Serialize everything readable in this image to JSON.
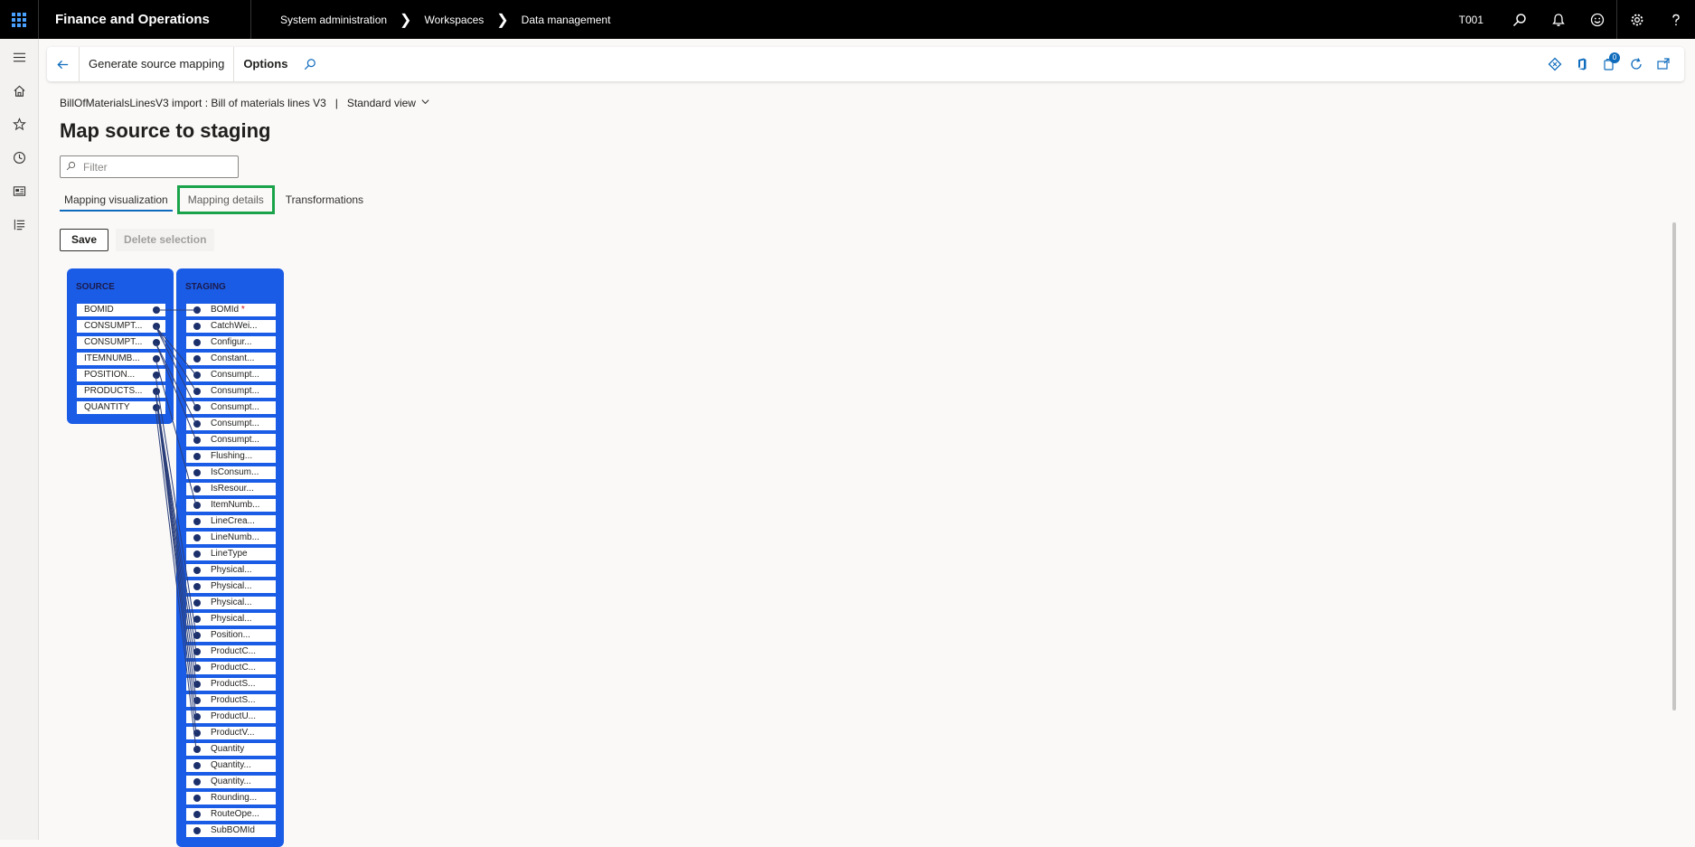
{
  "topbar": {
    "app_name": "Finance and Operations",
    "breadcrumbs": [
      "System administration",
      "Workspaces",
      "Data management"
    ],
    "company": "T001"
  },
  "actionbar": {
    "generate_label": "Generate source mapping",
    "options_label": "Options",
    "notification_count": "0"
  },
  "page": {
    "header_entity": "BillOfMaterialsLinesV3 import : Bill of materials lines V3",
    "header_separator": "|",
    "view_label": "Standard view",
    "title": "Map source to staging",
    "filter_placeholder": "Filter"
  },
  "tabs": [
    {
      "label": "Mapping visualization"
    },
    {
      "label": "Mapping details"
    },
    {
      "label": "Transformations"
    }
  ],
  "buttons": {
    "save": "Save",
    "delete_selection": "Delete selection"
  },
  "mapping": {
    "source_title": "SOURCE",
    "staging_title": "STAGING",
    "source_fields": [
      "BOMID",
      "CONSUMPT...",
      "CONSUMPT...",
      "ITEMNUMB...",
      "POSITION...",
      "PRODUCTS...",
      "QUANTITY"
    ],
    "staging_fields": [
      "BOMId",
      "CatchWei...",
      "Configur...",
      "Constant...",
      "Consumpt...",
      "Consumpt...",
      "Consumpt...",
      "Consumpt...",
      "Consumpt...",
      "Flushing...",
      "IsConsum...",
      "IsResour...",
      "ItemNumb...",
      "LineCrea...",
      "LineNumb...",
      "LineType",
      "Physical...",
      "Physical...",
      "Physical...",
      "Physical...",
      "Position...",
      "ProductC...",
      "ProductC...",
      "ProductS...",
      "ProductS...",
      "ProductU...",
      "ProductV...",
      "Quantity",
      "Quantity...",
      "Quantity...",
      "Rounding...",
      "RouteOpe...",
      "SubBOMId"
    ],
    "required_marker": "*"
  },
  "colors": {
    "panel_blue": "#1a5ce6",
    "dot": "#1b2f6b",
    "highlight_green": "#1aa34a",
    "accent": "#0f6cbd"
  }
}
